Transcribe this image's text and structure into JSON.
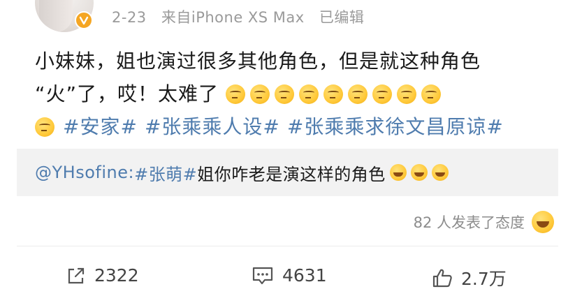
{
  "post": {
    "date": "2-23",
    "source": "来自iPhone XS Max",
    "edited": "已编辑",
    "line1": "小妹妹，姐也演过很多其他角色，但是就这种角色",
    "line2_text": "“火”了，哎！太难了",
    "emoji_name": "smirk-emoji",
    "hashtags": [
      "#安家#",
      "#张乘乘人设#",
      "#张乘乘求徐文昌原谅#"
    ]
  },
  "repost": {
    "user": "@YHsofine:",
    "hashtag": "#张萌#",
    "text": "姐你咋老是演这样的角色"
  },
  "attitude": {
    "label": "82 人发表了态度"
  },
  "actions": {
    "share_count": "2322",
    "comment_count": "4631",
    "like_count": "2.7万"
  },
  "colors": {
    "link": "#4f7cae",
    "meta": "#9a9a9a",
    "repost_bg": "#f2f2f2"
  }
}
